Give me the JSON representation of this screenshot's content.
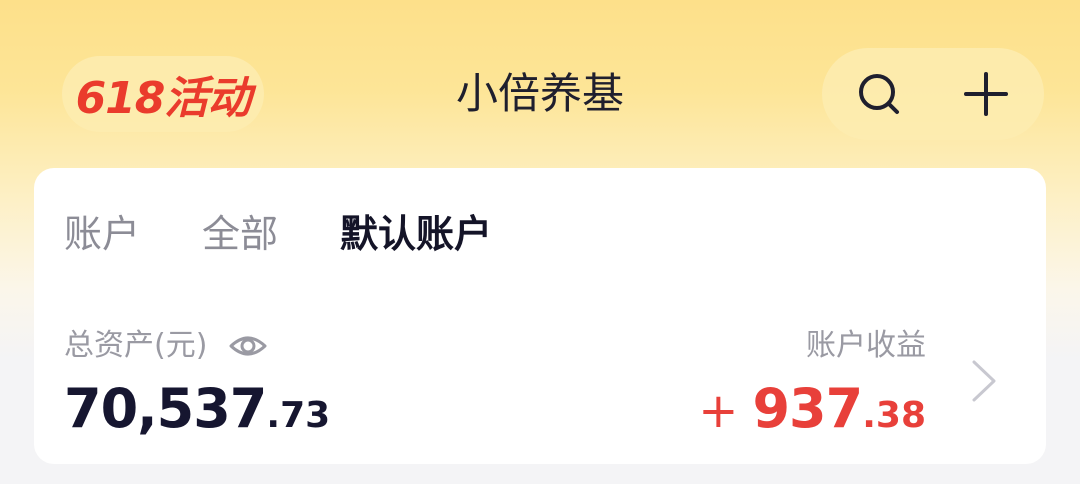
{
  "header": {
    "promo_label": "618活动",
    "title": "小倍养基",
    "actions": [
      {
        "icon": "search-icon"
      },
      {
        "icon": "plus-icon"
      }
    ]
  },
  "account_card": {
    "tabs": [
      {
        "label": "账户",
        "active": false
      },
      {
        "label": "全部",
        "active": false
      },
      {
        "label": "默认账户",
        "active": true
      }
    ],
    "total_assets": {
      "label": "总资产(元)",
      "integer": "70,537",
      "decimal": ".73",
      "visibility_icon": "eye-icon"
    },
    "account_profit": {
      "label": "账户收益",
      "sign": "+",
      "integer": "937",
      "decimal": ".38"
    },
    "detail_icon": "chevron-right-icon"
  },
  "colors": {
    "accent_red": "#e8403a",
    "promo_red": "#ea3b2c",
    "header_yellow": "#fde08a",
    "text_dark": "#161630",
    "text_muted": "#9a9aa3"
  }
}
